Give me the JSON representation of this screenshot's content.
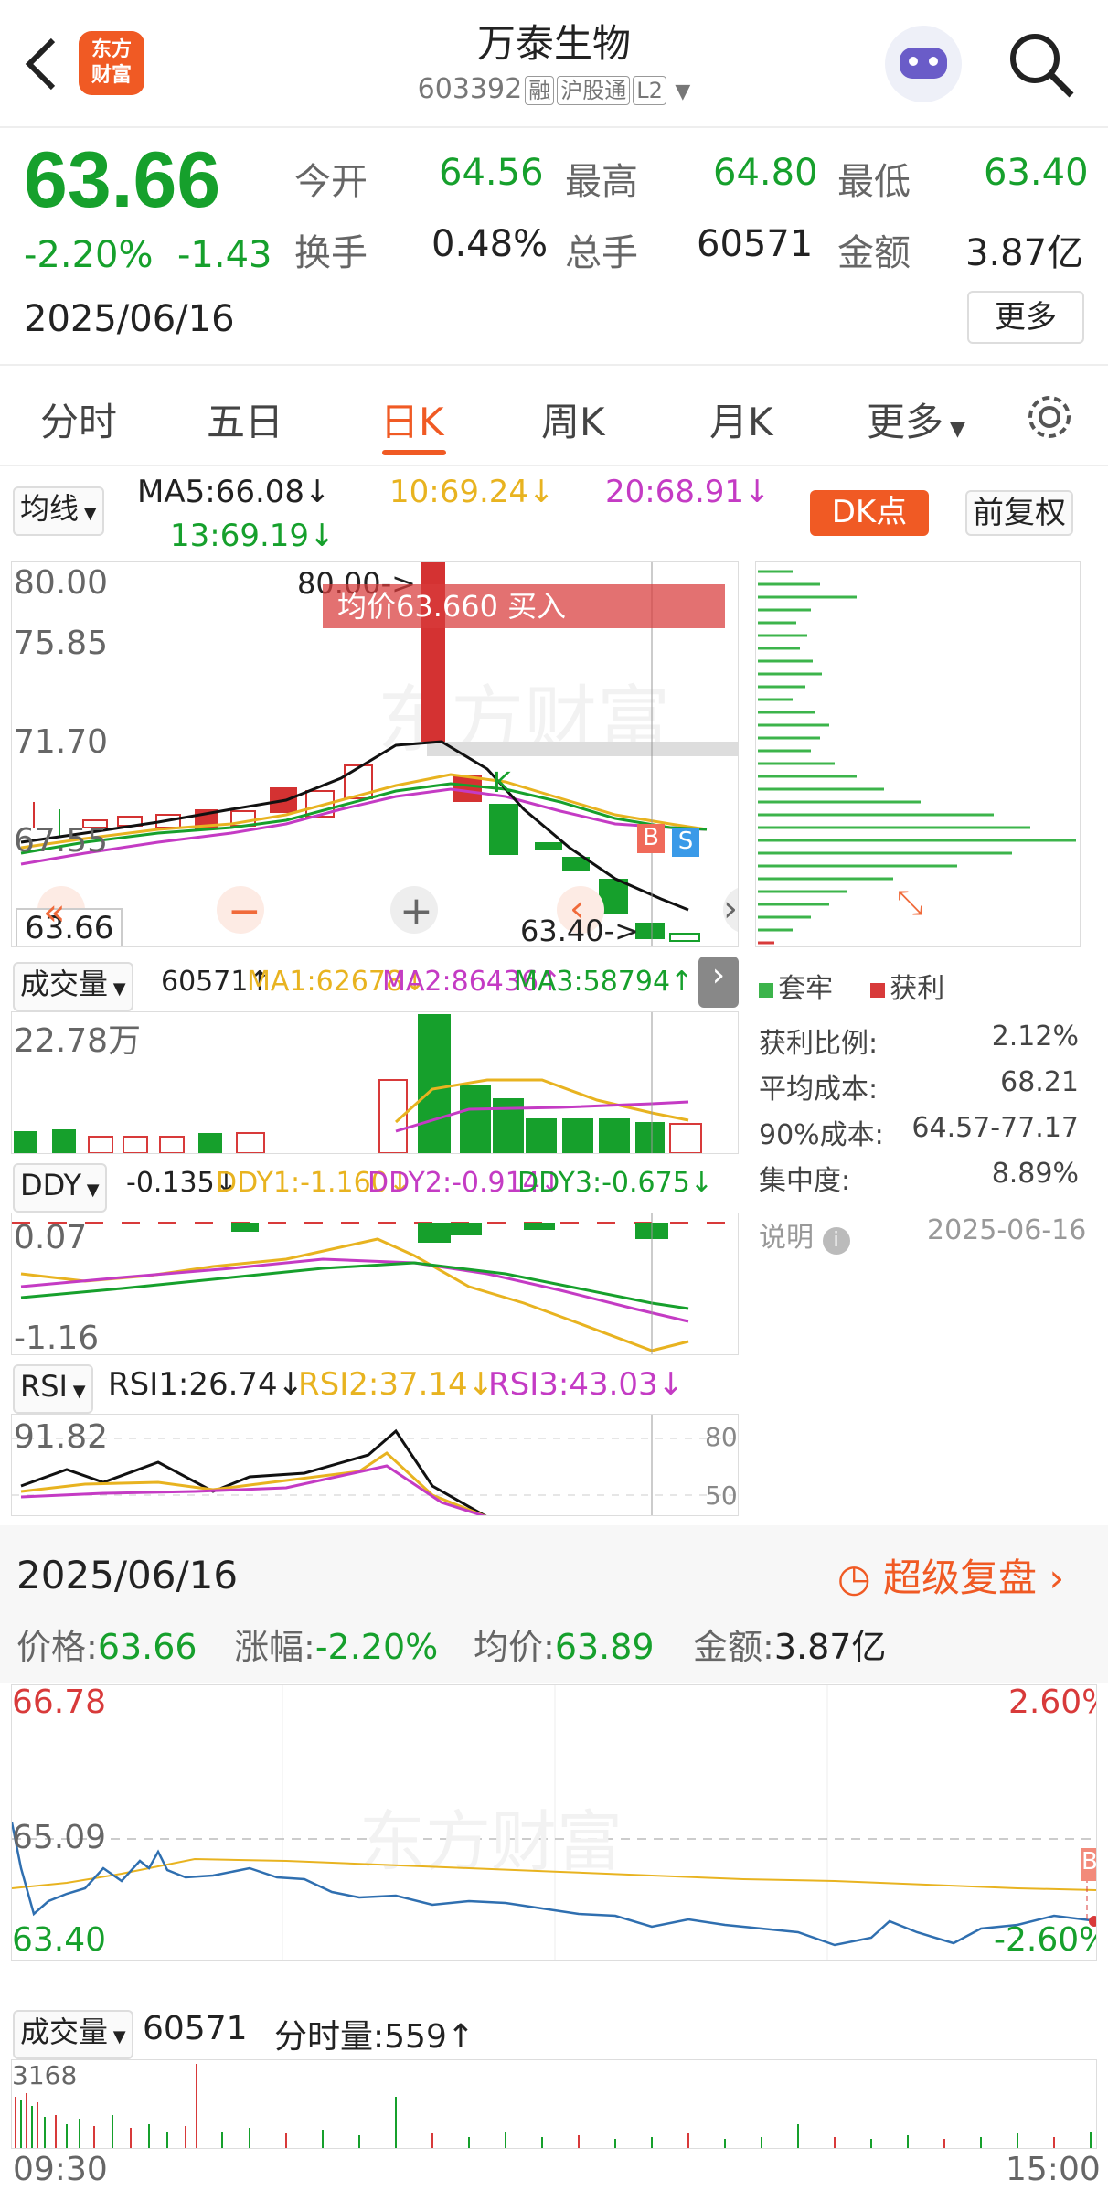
{
  "header": {
    "back_icon": "chevron-left-icon",
    "logo_text": "东方\n财富",
    "title": "万泰生物",
    "code": "603392",
    "tags": [
      "融",
      "沪股通",
      "L2"
    ],
    "search_icon": "search-icon",
    "robot_icon": "robot-avatar-icon"
  },
  "quote": {
    "price": "63.66",
    "change_pct": "-2.20%",
    "change": "-1.43",
    "date": "2025/06/16",
    "open_label": "今开",
    "open": "64.56",
    "high_label": "最高",
    "high": "64.80",
    "low_label": "最低",
    "low": "63.40",
    "turnover_label": "换手",
    "turnover": "0.48%",
    "volume_label": "总手",
    "volume": "60571",
    "amount_label": "金额",
    "amount": "3.87亿",
    "more": "更多"
  },
  "tabs": [
    "分时",
    "五日",
    "日K",
    "周K",
    "月K",
    "更多"
  ],
  "active_tab": "日K",
  "kline": {
    "ma_select": "均线",
    "ma5": "MA5:66.08↓",
    "ma10": "10:69.24↓",
    "ma20": "20:68.91↓",
    "ma13": "13:69.19↓",
    "dk": "DK点",
    "adjust": "前复权",
    "axis": [
      "80.00",
      "75.85",
      "71.70",
      "67.55",
      "63.66"
    ],
    "high_mark": "80.00->",
    "low_mark": "63.40->",
    "avg_banner": "均价63.660  买入",
    "signal_b": "B",
    "signal_s": "S",
    "signal_k": "K"
  },
  "volume": {
    "select": "成交量",
    "value": "60571↑",
    "ma1": "MA1:62678↓",
    "ma2": "MA2:86436↑",
    "ma3": "MA3:58794↑",
    "axis_top": "22.78万"
  },
  "ddy": {
    "select": "DDY",
    "value": "-0.135↓",
    "ddy1": "DDY1:-1.160↓",
    "ddy2": "DDY2:-0.914↓",
    "ddy3": "DDY3:-0.675↓",
    "axis_top": "0.07",
    "axis_bottom": "-1.16"
  },
  "rsi": {
    "select": "RSI",
    "rsi1": "RSI1:26.74↓",
    "rsi2": "RSI2:37.14↓",
    "rsi3": "RSI3:43.03↓",
    "axis_top": "91.82",
    "level80": "80",
    "level50": "50"
  },
  "chips": {
    "legend_trapped": "套牢",
    "legend_profit": "获利",
    "rows": [
      {
        "label": "获利比例:",
        "value": "2.12%"
      },
      {
        "label": "平均成本:",
        "value": "68.21"
      },
      {
        "label": "90%成本:",
        "value": "64.57-77.17"
      },
      {
        "label": "集中度:",
        "value": "8.89%"
      }
    ],
    "note": "说明",
    "date": "2025-06-16"
  },
  "intraday": {
    "date": "2025/06/16",
    "replay": "超级复盘",
    "price_label": "价格:",
    "price": "63.66",
    "change_label": "涨幅:",
    "change": "-2.20%",
    "avg_label": "均价:",
    "avg": "63.89",
    "amount_label": "金额:",
    "amount": "3.87亿",
    "axis_high": "66.78",
    "axis_mid": "65.09",
    "axis_low": "63.40",
    "pct_high": "2.60%",
    "pct_low": "-2.60%",
    "signal_b": "B",
    "vol_select": "成交量",
    "vol_value": "60571",
    "tick_vol": "分时量:559↑",
    "vol_axis": "3168",
    "time_start": "09:30",
    "time_end": "15:00"
  },
  "watermark": "东方财富",
  "colors": {
    "up": "#d83a3a",
    "down": "#16a02c",
    "accent": "#f05a24"
  }
}
